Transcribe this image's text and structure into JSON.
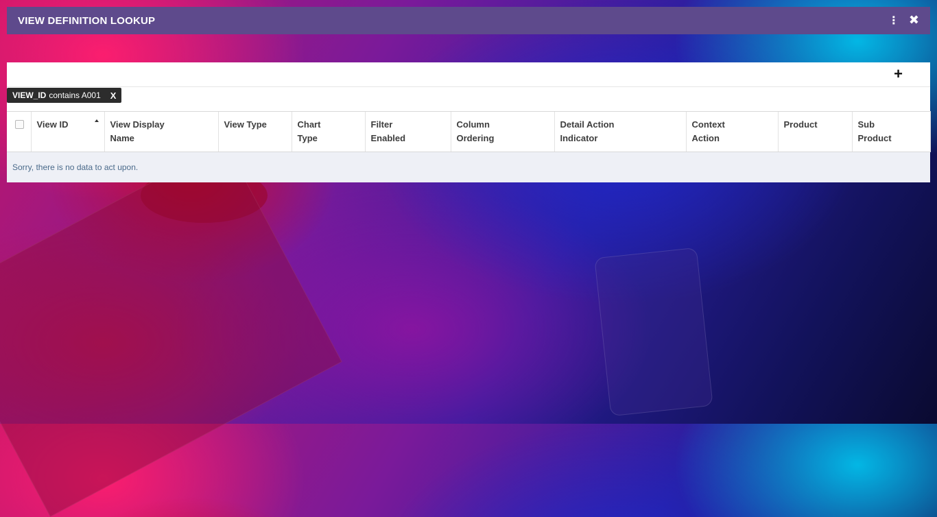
{
  "window": {
    "title": "VIEW DEFINITION LOOKUP",
    "menu_icon": "kebab-vertical-icon",
    "close_icon": "close-icon",
    "close_glyph": "✖",
    "menu_glyph": "⋮"
  },
  "toolbar": {
    "add_glyph": "+",
    "add_icon": "plus-icon"
  },
  "filter_chip": {
    "field": "VIEW_ID",
    "operator_value": "contains A001",
    "remove_label": "X"
  },
  "table": {
    "columns": [
      {
        "line1": "View ID",
        "line2": ""
      },
      {
        "line1": "View Display",
        "line2": "Name"
      },
      {
        "line1": "View Type",
        "line2": ""
      },
      {
        "line1": "Chart",
        "line2": "Type"
      },
      {
        "line1": "Filter",
        "line2": "Enabled"
      },
      {
        "line1": "Column",
        "line2": "Ordering"
      },
      {
        "line1": "Detail Action",
        "line2": "Indicator"
      },
      {
        "line1": "Context",
        "line2": "Action"
      },
      {
        "line1": "Product",
        "line2": ""
      },
      {
        "line1": "Sub",
        "line2": "Product"
      }
    ],
    "sorted_column": "View ID",
    "sort_direction": "ascending",
    "empty_message": "Sorry, there is no data to act upon."
  },
  "colors": {
    "titlebar": "#5e4a8c",
    "chip": "#2c2c2c",
    "empty_row": "#eef0f6"
  }
}
